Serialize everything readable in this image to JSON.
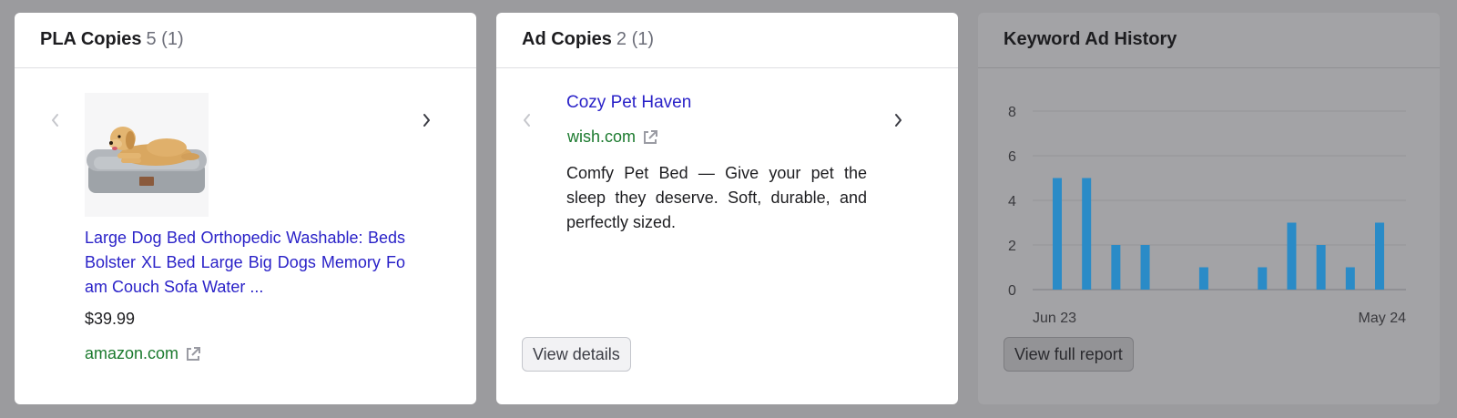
{
  "pla_card": {
    "title": "PLA Copies",
    "count": "5 (1)",
    "product": {
      "image": "golden retriever on grey dog bed",
      "title": "Large Dog Bed Orthopedic Washable: Beds Bolster XL Bed Large Big Dogs Memory Foam Couch Sofa Water ...",
      "price": "$39.99",
      "domain": "amazon.com"
    }
  },
  "ad_card": {
    "title": "Ad Copies",
    "count": "2 (1)",
    "ad": {
      "title": "Cozy Pet Haven",
      "domain": "wish.com",
      "description": "Comfy Pet Bed — Give your pet the sleep they deserve. Soft, durable, and perfectly sized."
    },
    "button_label": "View details"
  },
  "history_card": {
    "title": "Keyword Ad History",
    "button_label": "View full report"
  },
  "icons": {
    "prev": "chevron-left-icon",
    "next": "chevron-right-icon",
    "external": "external-link-icon"
  },
  "colors": {
    "link": "#2a22c8",
    "domain": "#1b7a2e",
    "bar": "#2a8bc7"
  },
  "chart_data": {
    "type": "bar",
    "categories": [
      "Jun 23",
      "",
      "",
      "",
      "",
      "",
      "",
      "",
      "",
      "",
      "",
      "May 24"
    ],
    "values": [
      5,
      5,
      2,
      2,
      0,
      1,
      0,
      1,
      3,
      2,
      1,
      3
    ],
    "x_tick_labels": [
      "Jun 23",
      "May 24"
    ],
    "y_ticks": [
      0,
      2,
      4,
      6,
      8
    ],
    "ylim": [
      0,
      8
    ],
    "grid": true
  }
}
